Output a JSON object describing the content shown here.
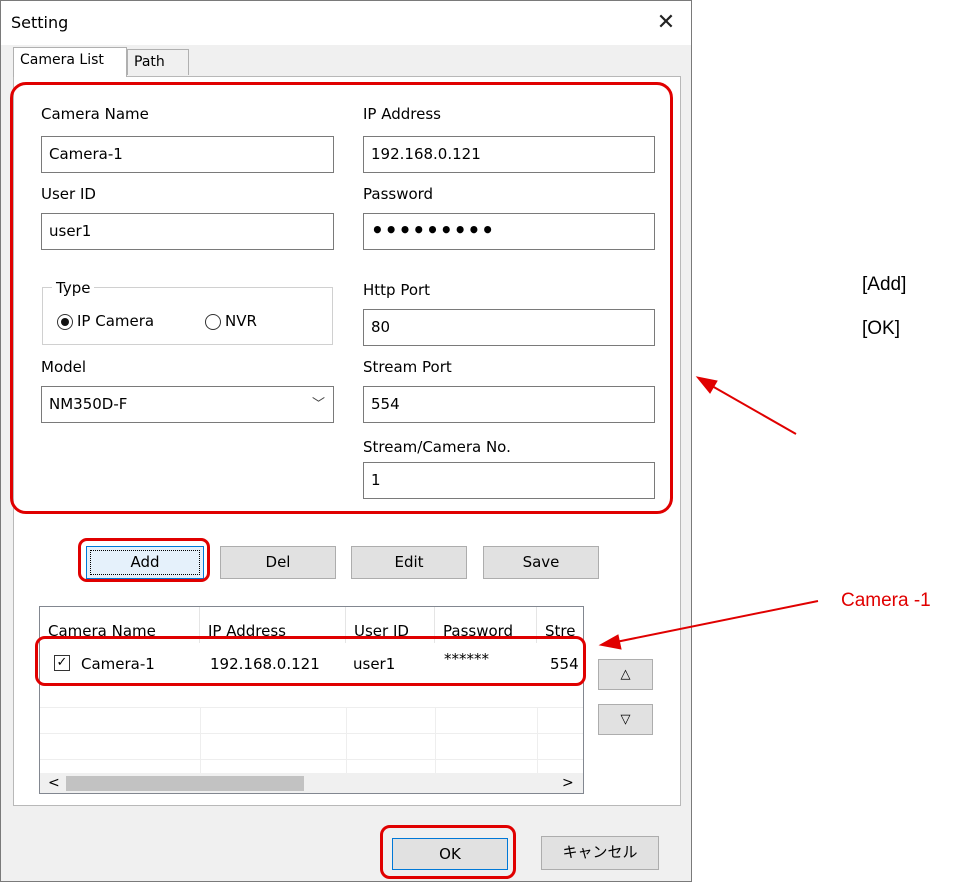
{
  "window": {
    "title": "Setting",
    "close_glyph": "✕"
  },
  "tabs": [
    {
      "label": "Camera List"
    },
    {
      "label": "Path"
    }
  ],
  "form": {
    "camera_name": {
      "label": "Camera Name",
      "value": "Camera-1"
    },
    "ip_address": {
      "label": "IP Address",
      "value": "192.168.0.121"
    },
    "user_id": {
      "label": "User ID",
      "value": "user1"
    },
    "password": {
      "label": "Password",
      "value": "•••••••••"
    },
    "type": {
      "label": "Type",
      "options": [
        "IP Camera",
        "NVR"
      ],
      "selected": "IP Camera"
    },
    "http_port": {
      "label": "Http Port",
      "value": "80"
    },
    "model": {
      "label": "Model",
      "value": "NM350D-F"
    },
    "stream_port": {
      "label": "Stream Port",
      "value": "554"
    },
    "stream_camera_no": {
      "label": "Stream/Camera No.",
      "value": "1"
    }
  },
  "buttons": {
    "add": "Add",
    "del": "Del",
    "edit": "Edit",
    "save": "Save",
    "ok": "OK",
    "cancel": "キャンセル"
  },
  "list": {
    "columns": [
      "Camera Name",
      "IP Address",
      "User ID",
      "Password",
      "Stre"
    ],
    "rows": [
      {
        "checked": true,
        "camera_name": "Camera-1",
        "ip": "192.168.0.121",
        "user_id": "user1",
        "password": "******",
        "stream": "554"
      }
    ],
    "up_glyph": "△",
    "down_glyph": "▽",
    "scroll_left": "<",
    "scroll_right": ">"
  },
  "annotations": {
    "step1": "[Add]",
    "step2": "[OK]",
    "camera_label": "Camera -1",
    "highlight_color": "#e00000"
  }
}
